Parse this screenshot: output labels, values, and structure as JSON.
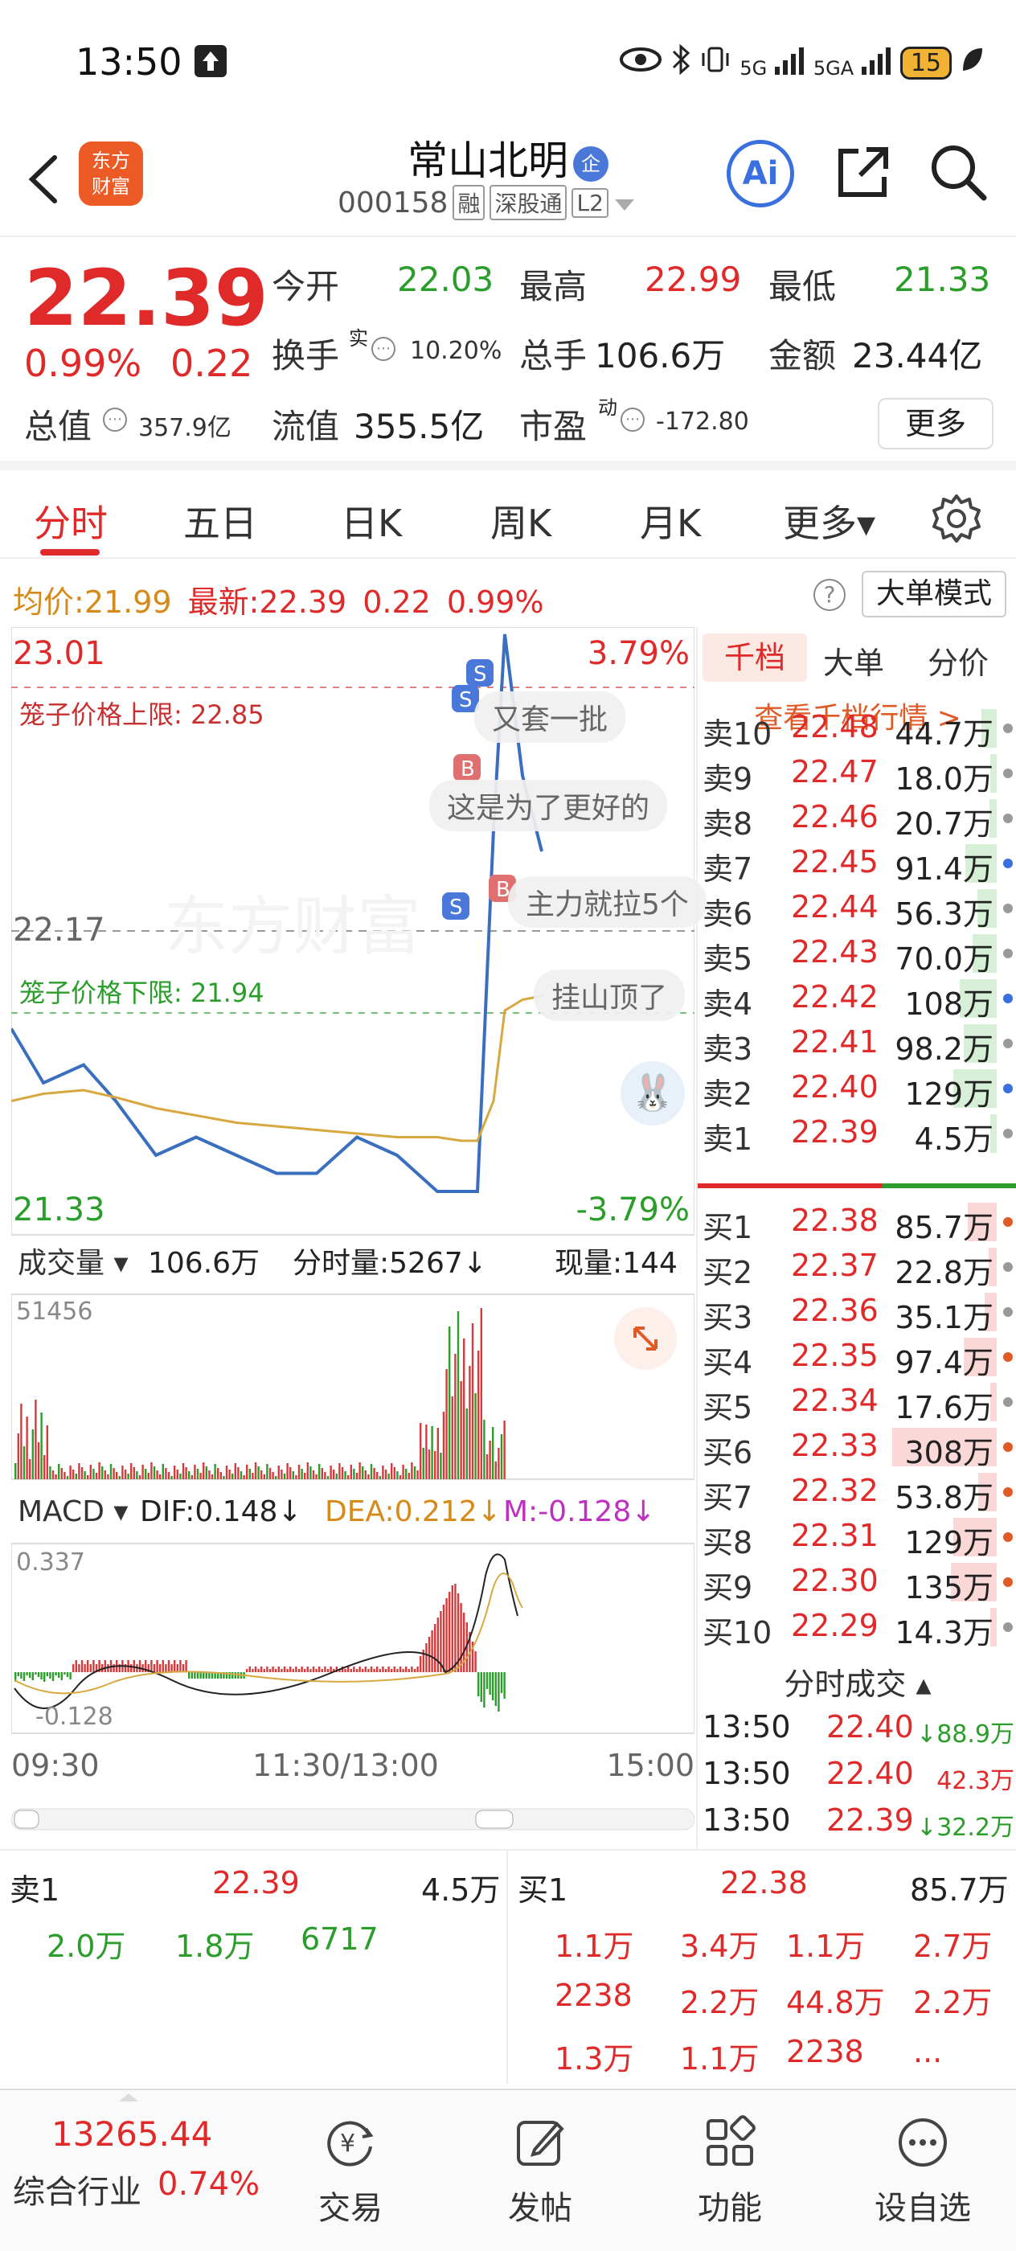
{
  "status": {
    "time": "13:50",
    "battery": "15",
    "net1": "5G",
    "net2": "5GA"
  },
  "header": {
    "name": "常山北明",
    "badge": "企",
    "code": "000158",
    "tags": [
      "融",
      "深股通",
      "L2"
    ],
    "logo_line1": "东方",
    "logo_line2": "财富",
    "ai_label": "Ai"
  },
  "quote": {
    "price": "22.39",
    "pct": "0.99%",
    "chg": "0.22",
    "open_label": "今开",
    "open": "22.03",
    "high_label": "最高",
    "high": "22.99",
    "low_label": "最低",
    "low": "21.33",
    "turnover_label": "换手",
    "turnover_sup": "实",
    "turnover": "10.20%",
    "vol_label": "总手",
    "vol": "106.6万",
    "amount_label": "金额",
    "amount": "23.44亿",
    "mktcap_label": "总值",
    "mktcap": "357.9亿",
    "float_label": "流值",
    "float": "355.5亿",
    "pe_label": "市盈",
    "pe_sup": "动",
    "pe": "-172.80",
    "more": "更多"
  },
  "tabs": [
    "分时",
    "五日",
    "日K",
    "周K",
    "月K",
    "更多▾"
  ],
  "avgbar": {
    "avg_label": "均价:",
    "avg": "21.99",
    "latest_label": "最新:",
    "latest": "22.39",
    "chg": "0.22",
    "pct": "0.99%",
    "help": "?",
    "bigmode": "大单模式"
  },
  "chart": {
    "top_price": "23.01",
    "top_pct": "3.79%",
    "mid_price": "22.17",
    "bottom_price": "21.33",
    "bottom_pct": "-3.79%",
    "upper_limit": "笼子价格上限: 22.85",
    "lower_limit": "笼子价格下限: 21.94",
    "watermark": "东方财富",
    "bubbles": [
      "又套一批",
      "这是为了更好的",
      "主力就拉5个",
      "挂山顶了"
    ],
    "vol_selector": "成交量",
    "vol_total": "106.6万",
    "vol_period": "分时量:5267↓",
    "vol_now": "现量:144",
    "vol_max": "51456",
    "macd_selector": "MACD",
    "dif": "DIF:0.148↓",
    "dea": "DEA:0.212↓",
    "m": "M:-0.128↓",
    "macd_top": "0.337",
    "macd_bottom": "-0.128",
    "t_start": "09:30",
    "t_mid": "11:30/13:00",
    "t_end": "15:00"
  },
  "chart_data": {
    "type": "line",
    "title": "",
    "xlabel": "",
    "ylabel": "",
    "ylim": [
      21.33,
      23.01
    ],
    "x": [
      "09:30",
      "09:40",
      "09:50",
      "10:00",
      "10:10",
      "10:20",
      "10:30",
      "10:40",
      "10:50",
      "11:00",
      "11:10",
      "11:20",
      "11:30/13:00",
      "13:10",
      "13:20",
      "13:30",
      "13:40",
      "13:50"
    ],
    "series": [
      {
        "name": "",
        "values": [
          21.9,
          21.75,
          21.8,
          21.7,
          21.55,
          21.6,
          21.55,
          21.5,
          21.5,
          21.6,
          21.55,
          21.45,
          21.45,
          21.45,
          22.45,
          22.99,
          22.6,
          22.39
        ]
      },
      {
        "name": "",
        "values": [
          21.7,
          21.72,
          21.73,
          21.71,
          21.68,
          21.66,
          21.64,
          21.63,
          21.62,
          21.61,
          21.6,
          21.6,
          21.59,
          21.59,
          21.7,
          21.95,
          21.98,
          21.99
        ]
      }
    ]
  },
  "book": {
    "tabs": [
      "千档",
      "大单",
      "分价"
    ],
    "view_more": "查看千档行情 >",
    "asks": [
      {
        "label": "卖10",
        "price": "22.48",
        "vol": "44.7万",
        "dot": "#999"
      },
      {
        "label": "卖9",
        "price": "22.47",
        "vol": "18.0万",
        "dot": "#999"
      },
      {
        "label": "卖8",
        "price": "22.46",
        "vol": "20.7万",
        "dot": "#999"
      },
      {
        "label": "卖7",
        "price": "22.45",
        "vol": "91.4万",
        "dot": "#3a6fe0"
      },
      {
        "label": "卖6",
        "price": "22.44",
        "vol": "56.3万",
        "dot": "#999"
      },
      {
        "label": "卖5",
        "price": "22.43",
        "vol": "70.0万",
        "dot": "#999"
      },
      {
        "label": "卖4",
        "price": "22.42",
        "vol": "108万",
        "dot": "#3a6fe0"
      },
      {
        "label": "卖3",
        "price": "22.41",
        "vol": "98.2万",
        "dot": "#999"
      },
      {
        "label": "卖2",
        "price": "22.40",
        "vol": "129万",
        "dot": "#3a6fe0"
      },
      {
        "label": "卖1",
        "price": "22.39",
        "vol": "4.5万",
        "dot": "#999"
      }
    ],
    "bids": [
      {
        "label": "买1",
        "price": "22.38",
        "vol": "85.7万",
        "dot": "#e05a25"
      },
      {
        "label": "买2",
        "price": "22.37",
        "vol": "22.8万",
        "dot": "#999"
      },
      {
        "label": "买3",
        "price": "22.36",
        "vol": "35.1万",
        "dot": "#999"
      },
      {
        "label": "买4",
        "price": "22.35",
        "vol": "97.4万",
        "dot": "#e05a25"
      },
      {
        "label": "买5",
        "price": "22.34",
        "vol": "17.6万",
        "dot": "#999"
      },
      {
        "label": "买6",
        "price": "22.33",
        "vol": "308万",
        "dot": "#e05a25"
      },
      {
        "label": "买7",
        "price": "22.32",
        "vol": "53.8万",
        "dot": "#e05a25"
      },
      {
        "label": "买8",
        "price": "22.31",
        "vol": "129万",
        "dot": "#e05a25"
      },
      {
        "label": "买9",
        "price": "22.30",
        "vol": "135万",
        "dot": "#e05a25"
      },
      {
        "label": "买10",
        "price": "22.29",
        "vol": "14.3万",
        "dot": "#999"
      }
    ],
    "trades_title": "分时成交",
    "trades": [
      {
        "time": "13:50",
        "price": "22.40",
        "vol": "↓88.9万"
      },
      {
        "time": "13:50",
        "price": "22.40",
        "vol": "42.3万"
      },
      {
        "time": "13:50",
        "price": "22.39",
        "vol": "↓32.2万"
      }
    ]
  },
  "summary": {
    "sell_label": "卖1",
    "sell_price": "22.39",
    "sell_vol": "4.5万",
    "buy_label": "买1",
    "buy_price": "22.38",
    "buy_vol": "85.7万",
    "sell_queue": [
      "2.0万",
      "1.8万",
      "6717"
    ],
    "buy_queue": [
      [
        "1.1万",
        "3.4万",
        "1.1万",
        "2.7万"
      ],
      [
        "2238",
        "2.2万",
        "44.8万",
        "2.2万"
      ],
      [
        "1.3万",
        "1.1万",
        "2238",
        "..."
      ]
    ]
  },
  "nav": {
    "index_value": "13265.44",
    "index_name": "综合行业",
    "index_pct": "0.74%",
    "items": [
      "交易",
      "发帖",
      "功能",
      "设自选"
    ]
  }
}
